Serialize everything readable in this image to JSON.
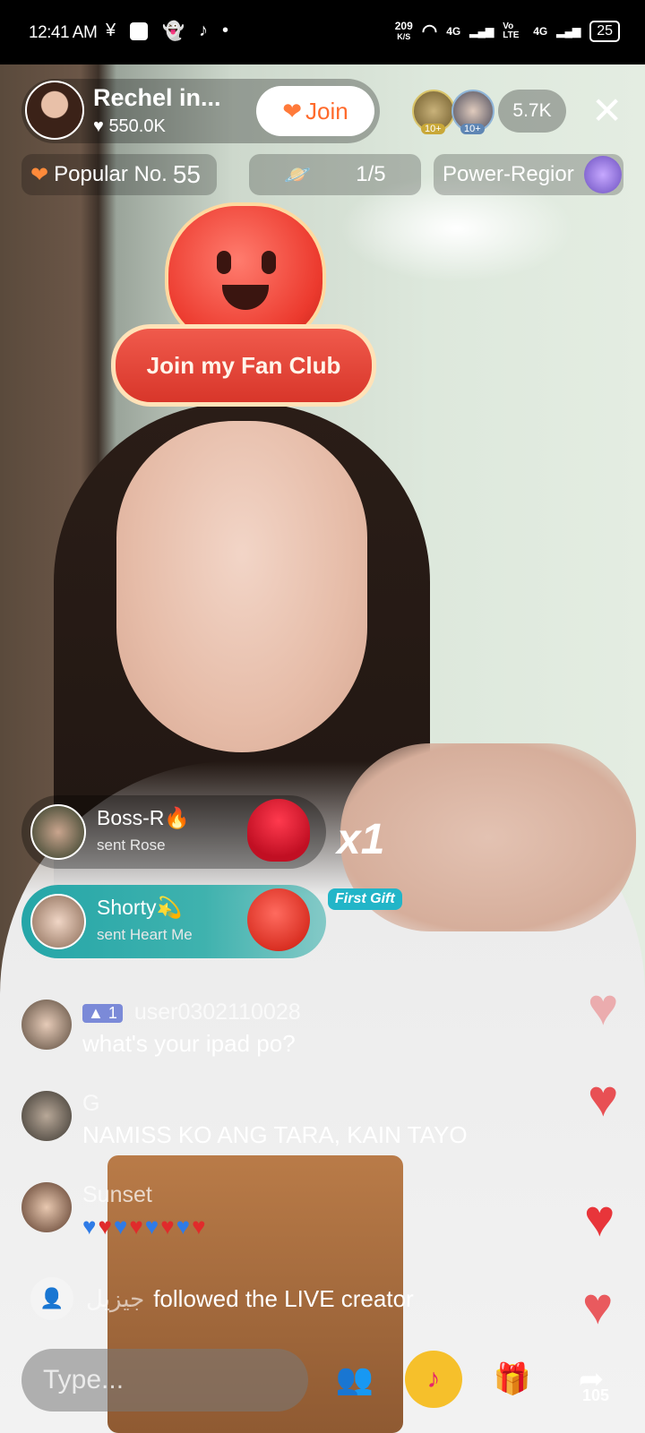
{
  "status_bar": {
    "time": "12:41 AM",
    "left_icons": [
      "yen-icon",
      "square-app-icon",
      "snapchat-icon",
      "tiktok-icon",
      "dot-icon"
    ],
    "net_speed_value": "209",
    "net_speed_unit": "K/S",
    "signal1": "4G",
    "volte": "Vo LTE",
    "signal2": "4G",
    "battery": "25"
  },
  "host": {
    "name": "Rechel in...",
    "likes": "550.0K",
    "join_label": "Join"
  },
  "viewers": {
    "badge1": "10+",
    "badge2": "10+",
    "count": "5.7K"
  },
  "pills": {
    "popular_label": "Popular No.",
    "popular_number": "55",
    "rank": "1/5",
    "power_region": "Power-Regior"
  },
  "fan_club": {
    "label": "Join my Fan Club"
  },
  "gifts": [
    {
      "name": "Boss-R🔥",
      "sub": "sent Rose",
      "combo": "x1"
    },
    {
      "name": "Shorty💫",
      "sub": "sent Heart Me",
      "tag": "First Gift"
    }
  ],
  "comments": [
    {
      "badge": "1",
      "user": "user0302110028",
      "text": "what's your ipad po?"
    },
    {
      "user": "G",
      "text": "NAMISS KO ANG TARA, KAIN TAYO"
    },
    {
      "user": "Sunset"
    }
  ],
  "follow": {
    "user": "جيزيل",
    "text": "followed the LIVE creator"
  },
  "bottom_bar": {
    "placeholder": "Type...",
    "share_count": "105"
  },
  "colors": {
    "join_text": "#ff6a2b",
    "gift2_bg": "#25a6a8",
    "first_gift": "#22b5c8",
    "heart_red": "#e8353a"
  }
}
